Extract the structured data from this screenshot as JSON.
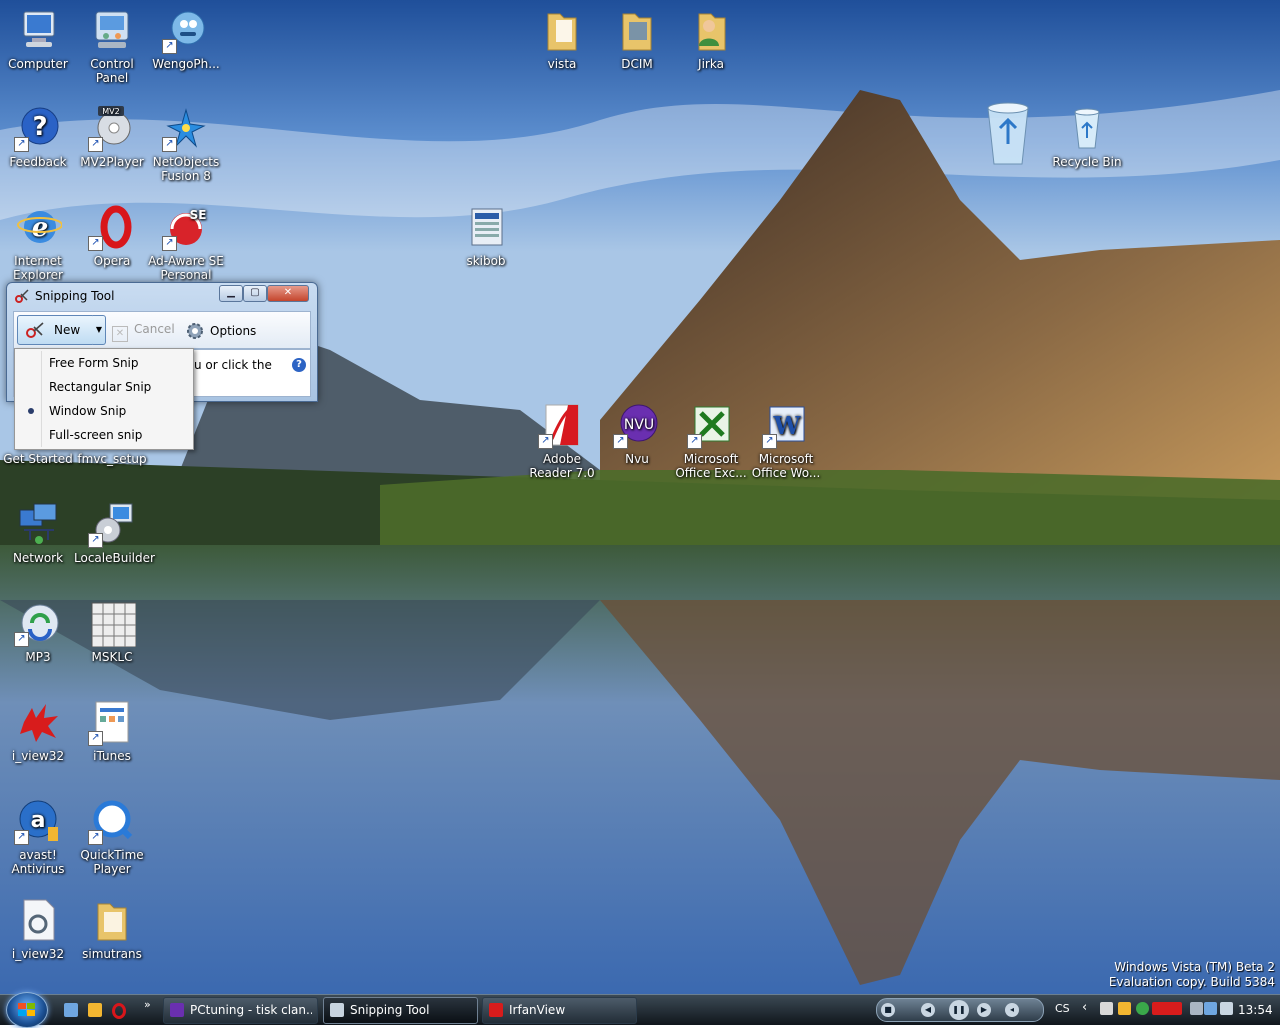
{
  "desktop": {
    "icons": [
      {
        "label": "Computer",
        "icon": "computer-icon"
      },
      {
        "label": "Control Panel",
        "icon": "control-panel-icon"
      },
      {
        "label": "WengoPh...",
        "icon": "wengophone-icon"
      },
      {
        "label": "vista",
        "icon": "folder-icon"
      },
      {
        "label": "DCIM",
        "icon": "folder-icon"
      },
      {
        "label": "Jirka",
        "icon": "user-folder-icon"
      },
      {
        "label": "Feedback",
        "icon": "help-icon"
      },
      {
        "label": "MV2Player",
        "icon": "mv2player-icon"
      },
      {
        "label": "NetObjects Fusion 8",
        "icon": "netobjects-icon"
      },
      {
        "label": "Recycle Bin",
        "icon": "recycle-bin-icon"
      },
      {
        "label": "Internet Explorer",
        "icon": "internet-explorer-icon"
      },
      {
        "label": "Opera",
        "icon": "opera-icon"
      },
      {
        "label": "Ad-Aware SE Personal",
        "icon": "adaware-icon"
      },
      {
        "label": "skibob",
        "icon": "document-icon"
      },
      {
        "label": "Get Started",
        "icon": "get-started-icon"
      },
      {
        "label": "fmvc_setup",
        "icon": "setup-icon"
      },
      {
        "label": "Adobe Reader 7.0",
        "icon": "adobe-reader-icon"
      },
      {
        "label": "Nvu",
        "icon": "nvu-icon"
      },
      {
        "label": "Microsoft Office Exc...",
        "icon": "excel-icon"
      },
      {
        "label": "Microsoft Office Wo...",
        "icon": "word-icon"
      },
      {
        "label": "Network",
        "icon": "network-icon"
      },
      {
        "label": "LocaleBuilder",
        "icon": "localebuilder-icon"
      },
      {
        "label": "MP3",
        "icon": "mp3-icon"
      },
      {
        "label": "MSKLC",
        "icon": "keyboard-icon"
      },
      {
        "label": "i_view32",
        "icon": "irfanview-icon"
      },
      {
        "label": "iTunes",
        "icon": "itunes-icon"
      },
      {
        "label": "avast! Antivirus",
        "icon": "avast-icon"
      },
      {
        "label": "QuickTime Player",
        "icon": "quicktime-icon"
      },
      {
        "label": "i_view32",
        "icon": "config-file-icon"
      },
      {
        "label": "simutrans",
        "icon": "folder-icon"
      }
    ],
    "watermark": {
      "line1": "Windows Vista (TM) Beta 2",
      "line2": "Evaluation copy. Build 5384"
    }
  },
  "snipping_tool": {
    "title": "Snipping Tool",
    "toolbar": {
      "new_label": "New",
      "cancel_label": "Cancel",
      "options_label": "Options"
    },
    "instruction_fragment": "u or click the",
    "menu": {
      "items": [
        {
          "label": "Free Form Snip",
          "selected": false
        },
        {
          "label": "Rectangular Snip",
          "selected": false
        },
        {
          "label": "Window Snip",
          "selected": true
        },
        {
          "label": "Full-screen snip",
          "selected": false
        }
      ]
    }
  },
  "taskbar": {
    "tasks": [
      {
        "label": "PCtuning - tisk clan...",
        "active": false
      },
      {
        "label": "Snipping Tool",
        "active": true
      },
      {
        "label": "IrfanView",
        "active": false
      }
    ],
    "language": "CS",
    "clock": "13:54"
  },
  "colors": {
    "taskbar": "#1a232c",
    "accent": "#2d64c4"
  }
}
